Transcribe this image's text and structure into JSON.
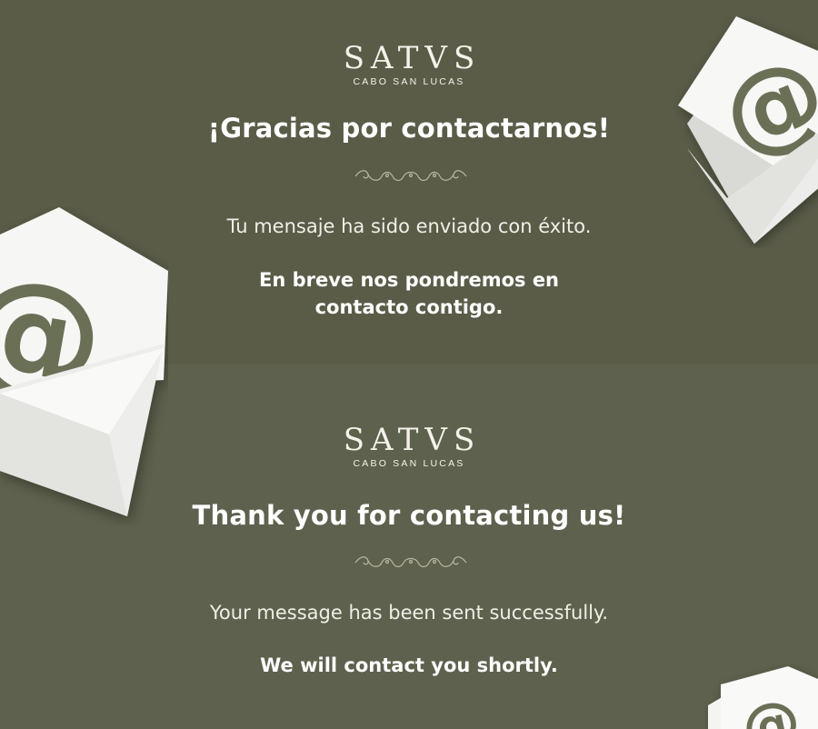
{
  "colors": {
    "panel_top": "#5a5c48",
    "panel_bottom": "#5e614d",
    "envelope_paper": "#f3f3f1",
    "at_symbol": "#6b6f56"
  },
  "spanish": {
    "logo": {
      "word": "SATVS",
      "sub": "CABO SAN LUCAS"
    },
    "title": "¡Gracias por contactarnos!",
    "message": "Tu mensaje ha sido enviado con éxito.",
    "followup_line1": "En breve nos pondremos en",
    "followup_line2": "contacto contigo."
  },
  "english": {
    "logo": {
      "word": "SATVS",
      "sub": "CABO SAN LUCAS"
    },
    "title": "Thank you for contacting us!",
    "message": "Your message has been sent successfully.",
    "followup": "We will contact you shortly."
  },
  "decorations": {
    "envelope_icon": "envelope-at-icon",
    "ornament_icon": "flourish-divider-icon"
  }
}
